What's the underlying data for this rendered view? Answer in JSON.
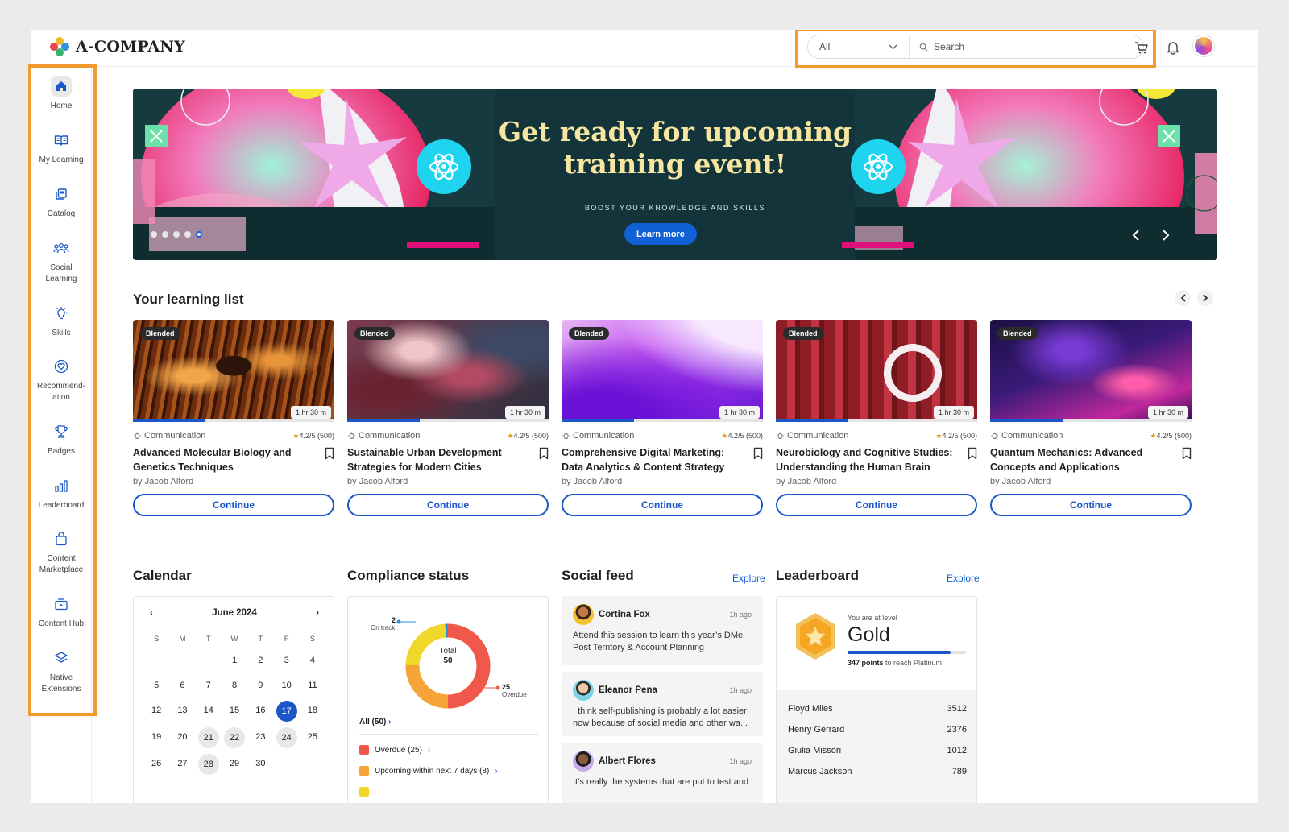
{
  "header": {
    "brand": "A-COMPANY",
    "search_filter": "All",
    "search_placeholder": "Search"
  },
  "icons": {
    "cart": "cart-icon",
    "bell": "bell-icon",
    "avatar": "avatar"
  },
  "colors": {
    "accent": "#1b57c8",
    "highlight": "#f29a2e",
    "banner_bg": "#12343a",
    "banner_title": "#f6e6a0"
  },
  "sidebar": {
    "items": [
      {
        "label": "Home",
        "icon": "home-icon"
      },
      {
        "label": "My Learning",
        "icon": "book-icon"
      },
      {
        "label": "Catalog",
        "icon": "catalog-icon"
      },
      {
        "label": "Social Learning",
        "icon": "people-icon"
      },
      {
        "label": "Skills",
        "icon": "lightbulb-icon"
      },
      {
        "label": "Recommend-ation",
        "icon": "heart-badge-icon"
      },
      {
        "label": "Badges",
        "icon": "trophy-icon"
      },
      {
        "label": "Leaderboard",
        "icon": "bar-chart-icon"
      },
      {
        "label": "Content Marketplace",
        "icon": "shopping-bag-icon"
      },
      {
        "label": "Content Hub",
        "icon": "content-hub-icon"
      },
      {
        "label": "Native Extensions",
        "icon": "layers-icon"
      }
    ]
  },
  "banner": {
    "title_line1": "Get ready for upcoming",
    "title_line2": "training event!",
    "subtitle": "BOOST YOUR KNOWLEDGE AND SKILLS",
    "cta": "Learn more",
    "slide_count": 5,
    "active_slide": 5
  },
  "learning_list": {
    "title": "Your learning list",
    "cards": [
      {
        "badge": "Blended",
        "duration": "1 hr 30 m",
        "category": "Communication",
        "rating": "4.2/5",
        "reviews": "(500)",
        "title": "Advanced Molecular Biology and Genetics Techniques",
        "author": "by Jacob Alford",
        "cta": "Continue",
        "progress": 0.36
      },
      {
        "badge": "Blended",
        "duration": "1 hr 30 m",
        "category": "Communication",
        "rating": "4.2/5",
        "reviews": "(500)",
        "title": "Sustainable Urban Development Strategies for Modern Cities",
        "author": "by Jacob Alford",
        "cta": "Continue",
        "progress": 0.36
      },
      {
        "badge": "Blended",
        "duration": "1 hr 30 m",
        "category": "Communication",
        "rating": "4.2/5",
        "reviews": "(500)",
        "title": "Comprehensive Digital Marketing: Data Analytics & Content Strategy",
        "author": "by Jacob Alford",
        "cta": "Continue",
        "progress": 0.36
      },
      {
        "badge": "Blended",
        "duration": "1 hr 30 m",
        "category": "Communication",
        "rating": "4.2/5",
        "reviews": "(500)",
        "title": "Neurobiology and Cognitive Studies: Understanding the Human Brain",
        "author": "by Jacob Alford",
        "cta": "Continue",
        "progress": 0.36
      },
      {
        "badge": "Blended",
        "duration": "1 hr 30 m",
        "category": "Communication",
        "rating": "4.2/5",
        "reviews": "(500)",
        "title": "Quantum Mechanics: Advanced Concepts and Applications",
        "author": "by Jacob Alford",
        "cta": "Continue",
        "progress": 0.36
      }
    ]
  },
  "calendar": {
    "title": "Calendar",
    "month": "June 2024",
    "weekdays": [
      "S",
      "M",
      "T",
      "W",
      "T",
      "F",
      "S"
    ],
    "leading_blanks": 3,
    "days": [
      "1",
      "2",
      "3",
      "4",
      "5",
      "6",
      "7",
      "8",
      "9",
      "10",
      "11",
      "12",
      "13",
      "14",
      "15",
      "16",
      "17",
      "18",
      "19",
      "20",
      "21",
      "22",
      "23",
      "24",
      "25",
      "26",
      "27",
      "28",
      "29",
      "30"
    ],
    "selected_day": "17",
    "highlighted_days": [
      "21",
      "22",
      "24",
      "28"
    ]
  },
  "compliance": {
    "title": "Compliance status",
    "total_label": "Total",
    "total_value": "50",
    "on_track_value": "2",
    "on_track_label": "On track",
    "overdue_value": "25",
    "overdue_label": "Overdue",
    "all_label": "All (50)",
    "legend": [
      {
        "label": "Overdue (25)",
        "color": "#f0584c"
      },
      {
        "label": "Upcoming within next 7 days (8)",
        "color": "#f6a43a"
      }
    ]
  },
  "social_feed": {
    "title": "Social feed",
    "explore": "Explore",
    "posts": [
      {
        "name": "Cortina Fox",
        "time": "1h ago",
        "text": "Attend this session to learn this year’s DMe Post Territory & Account Planning"
      },
      {
        "name": "Eleanor Pena",
        "time": "1h ago",
        "text": "I think self-publishing is probably a lot easier now because of social media and other wa..."
      },
      {
        "name": "Albert Flores",
        "time": "1h ago",
        "text": "It’s really the systems that are put to test and"
      }
    ]
  },
  "leaderboard": {
    "title": "Leaderboard",
    "explore": "Explore",
    "level_caption": "You are at level",
    "level": "Gold",
    "points": "347 points",
    "points_suffix": " to reach Platinum",
    "progress": 0.87,
    "rows": [
      {
        "name": "Floyd Miles",
        "score": "3512"
      },
      {
        "name": "Henry Gerrard",
        "score": "2376"
      },
      {
        "name": "Giulia Missori",
        "score": "1012"
      },
      {
        "name": "Marcus Jackson",
        "score": "789"
      }
    ]
  }
}
